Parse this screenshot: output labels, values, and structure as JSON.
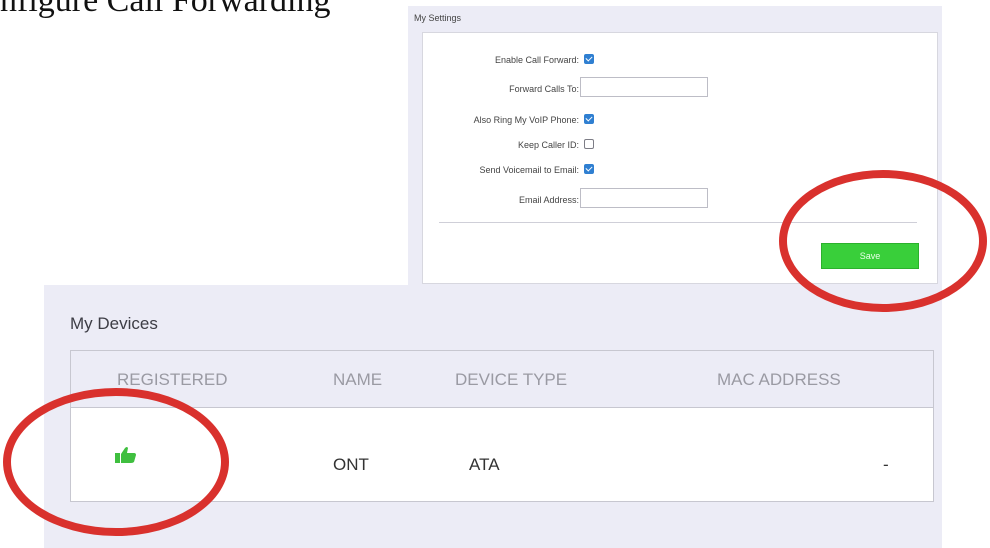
{
  "page_fragment": "nfigure Call Forwarding",
  "settings": {
    "title": "My Settings",
    "fields": [
      {
        "label": "Enable Call Forward:",
        "type": "checkbox",
        "checked": true
      },
      {
        "label": "Forward Calls To:",
        "type": "text",
        "value": ""
      },
      {
        "label": "Also Ring My VoIP Phone:",
        "type": "checkbox",
        "checked": true
      },
      {
        "label": "Keep Caller ID:",
        "type": "checkbox",
        "checked": false
      },
      {
        "label": "Send Voicemail to Email:",
        "type": "checkbox",
        "checked": true
      },
      {
        "label": "Email Address:",
        "type": "text",
        "value": ""
      }
    ],
    "save_label": "Save",
    "save_color": "#39cf3a"
  },
  "devices": {
    "title": "My Devices",
    "columns": [
      "REGISTERED",
      "NAME",
      "DEVICE TYPE",
      "MAC ADDRESS"
    ],
    "rows": [
      {
        "registered_icon": "thumbs-up-icon",
        "name": "ONT",
        "device_type": "ATA",
        "mac_address": "-"
      }
    ]
  },
  "colors": {
    "annotation": "#d9312d",
    "registered_icon": "#3fbf3f",
    "checkbox_checked": "#2f7fd1"
  }
}
